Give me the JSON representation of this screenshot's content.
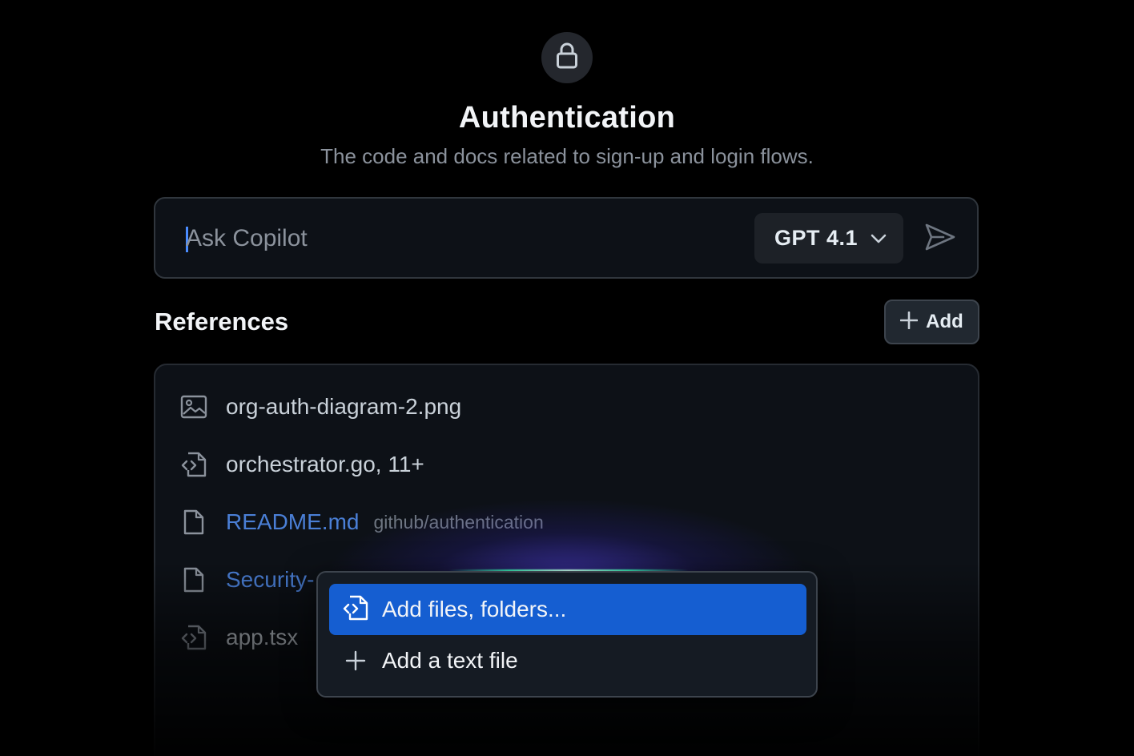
{
  "header": {
    "icon": "lock-icon",
    "title": "Authentication",
    "subtitle": "The code and docs related to sign-up and login flows."
  },
  "ask": {
    "placeholder": "Ask Copilot",
    "value": "",
    "model": "GPT 4.1",
    "send_icon": "send-icon"
  },
  "references": {
    "heading": "References",
    "add_label": "Add",
    "items": [
      {
        "icon": "image-icon",
        "name": "org-auth-diagram-2.png",
        "path": ""
      },
      {
        "icon": "code-file-icon",
        "name": "orchestrator.go, 11+",
        "path": ""
      },
      {
        "icon": "file-icon",
        "name": "README.md",
        "path": "github/authentication"
      },
      {
        "icon": "file-icon",
        "name": "Security-",
        "path": ""
      },
      {
        "icon": "code-file-icon",
        "name": "app.tsx",
        "path": ""
      }
    ]
  },
  "add_menu": {
    "items": [
      {
        "icon": "code-file-icon",
        "label": "Add files, folders...",
        "highlighted": true
      },
      {
        "icon": "plus-icon",
        "label": "Add a text file",
        "highlighted": false
      }
    ]
  },
  "colors": {
    "background": "#000000",
    "accent": "#155ed1",
    "link": "#4a7fd6",
    "glow": "#5a46ff"
  }
}
